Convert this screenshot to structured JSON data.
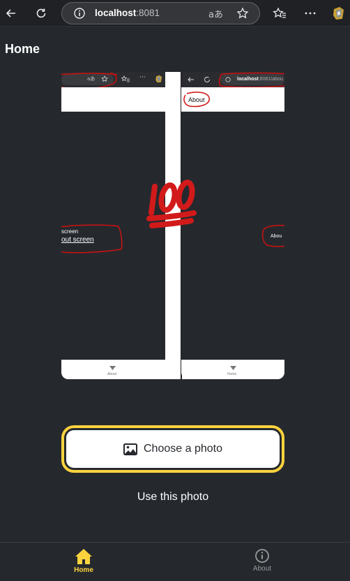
{
  "browser": {
    "url_host": "localhost",
    "url_port": ":8081",
    "translate_glyph": "aあ",
    "icons": [
      "back-arrow-icon",
      "reload-icon",
      "info-icon",
      "translate-icon",
      "star-icon",
      "favorites-icon",
      "more-icon",
      "extension-icon"
    ]
  },
  "page": {
    "title": "Home"
  },
  "picture": {
    "left_about_small": "screen",
    "left_about_link": "out screen",
    "left_tab_label": "About",
    "right_url_host": "localhost",
    "right_url_rest": ":8081/abou",
    "right_about_badge": "About",
    "right_about_side": "Abou",
    "right_tab_label": "Home"
  },
  "actions": {
    "choose_label": "Choose a photo",
    "use_label": "Use this photo"
  },
  "tabs": [
    {
      "label": "Home",
      "icon": "home-icon",
      "active": true
    },
    {
      "label": "About",
      "icon": "info-circle-icon",
      "active": false
    }
  ],
  "colors": {
    "background": "#25292e",
    "accent": "#ffd33d",
    "annotation_red": "#d01010"
  }
}
